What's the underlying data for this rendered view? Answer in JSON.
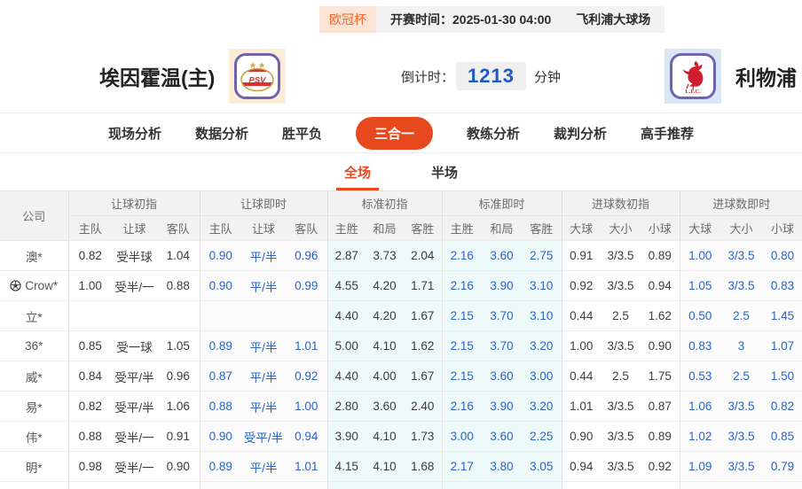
{
  "top_bar": {
    "league_badge": "欧冠杯",
    "kickoff_label": "开赛时间：2025-01-30 04:00",
    "venue": "飞利浦大球场"
  },
  "match": {
    "home_name": "埃因霍温(主)",
    "home_logo_text": "PSV",
    "away_name": "利物浦",
    "away_logo_text": "L.F.C.",
    "countdown_label": "倒计时：",
    "countdown_value": "1213",
    "countdown_unit": "分钟"
  },
  "nav": {
    "tabs": [
      {
        "key": "live-analysis",
        "label": "现场分析",
        "active": false
      },
      {
        "key": "data-analysis",
        "label": "数据分析",
        "active": false
      },
      {
        "key": "win-draw-lose",
        "label": "胜平负",
        "active": false
      },
      {
        "key": "three-in-one",
        "label": "三合一",
        "active": true
      },
      {
        "key": "coach-analysis",
        "label": "教练分析",
        "active": false
      },
      {
        "key": "referee-analysis",
        "label": "裁判分析",
        "active": false
      },
      {
        "key": "expert-picks",
        "label": "高手推荐",
        "active": false
      }
    ]
  },
  "sub_tabs": [
    {
      "key": "full-match",
      "label": "全场",
      "active": true
    },
    {
      "key": "half-match",
      "label": "半场",
      "active": false
    }
  ],
  "odds_table": {
    "company_header": "公司",
    "groups": [
      {
        "key": "handicap_initial",
        "label": "让球初指",
        "cols": [
          "主队",
          "让球",
          "客队"
        ]
      },
      {
        "key": "handicap_live",
        "label": "让球即时",
        "cols": [
          "主队",
          "让球",
          "客队"
        ]
      },
      {
        "key": "euro_initial",
        "label": "标准初指",
        "cols": [
          "主胜",
          "和局",
          "客胜"
        ]
      },
      {
        "key": "euro_live",
        "label": "标准即时",
        "cols": [
          "主胜",
          "和局",
          "客胜"
        ]
      },
      {
        "key": "goals_initial",
        "label": "进球数初指",
        "cols": [
          "大球",
          "大小",
          "小球"
        ]
      },
      {
        "key": "goals_live",
        "label": "进球数即时",
        "cols": [
          "大球",
          "大小",
          "小球"
        ]
      }
    ],
    "rows": [
      {
        "company": "澳*",
        "has_ball_icon": false,
        "handicap_initial": [
          "0.82",
          "受半球",
          "1.04"
        ],
        "handicap_live": [
          "0.90",
          "平/半",
          "0.96"
        ],
        "euro_initial": [
          "2.87",
          "3.73",
          "2.04"
        ],
        "euro_live": [
          "2.16",
          "3.60",
          "2.75"
        ],
        "goals_initial": [
          "0.91",
          "3/3.5",
          "0.89"
        ],
        "goals_live": [
          "1.00",
          "3/3.5",
          "0.80"
        ]
      },
      {
        "company": "Crow*",
        "has_ball_icon": true,
        "handicap_initial": [
          "1.00",
          "受半/一",
          "0.88"
        ],
        "handicap_live": [
          "0.90",
          "平/半",
          "0.99"
        ],
        "euro_initial": [
          "4.55",
          "4.20",
          "1.71"
        ],
        "euro_live": [
          "2.16",
          "3.90",
          "3.10"
        ],
        "goals_initial": [
          "0.92",
          "3/3.5",
          "0.94"
        ],
        "goals_live": [
          "1.05",
          "3/3.5",
          "0.83"
        ]
      },
      {
        "company": "立*",
        "has_ball_icon": false,
        "handicap_initial": [
          "",
          "",
          ""
        ],
        "handicap_live": [
          "",
          "",
          ""
        ],
        "euro_initial": [
          "4.40",
          "4.20",
          "1.67"
        ],
        "euro_live": [
          "2.15",
          "3.70",
          "3.10"
        ],
        "goals_initial": [
          "0.44",
          "2.5",
          "1.62"
        ],
        "goals_live": [
          "0.50",
          "2.5",
          "1.45"
        ]
      },
      {
        "company": "36*",
        "has_ball_icon": false,
        "handicap_initial": [
          "0.85",
          "受一球",
          "1.05"
        ],
        "handicap_live": [
          "0.89",
          "平/半",
          "1.01"
        ],
        "euro_initial": [
          "5.00",
          "4.10",
          "1.62"
        ],
        "euro_live": [
          "2.15",
          "3.70",
          "3.20"
        ],
        "goals_initial": [
          "1.00",
          "3/3.5",
          "0.90"
        ],
        "goals_live": [
          "0.83",
          "3",
          "1.07"
        ]
      },
      {
        "company": "威*",
        "has_ball_icon": false,
        "handicap_initial": [
          "0.84",
          "受平/半",
          "0.96"
        ],
        "handicap_live": [
          "0.87",
          "平/半",
          "0.92"
        ],
        "euro_initial": [
          "4.40",
          "4.00",
          "1.67"
        ],
        "euro_live": [
          "2.15",
          "3.60",
          "3.00"
        ],
        "goals_initial": [
          "0.44",
          "2.5",
          "1.75"
        ],
        "goals_live": [
          "0.53",
          "2.5",
          "1.50"
        ]
      },
      {
        "company": "易*",
        "has_ball_icon": false,
        "handicap_initial": [
          "0.82",
          "受平/半",
          "1.06"
        ],
        "handicap_live": [
          "0.88",
          "平/半",
          "1.00"
        ],
        "euro_initial": [
          "2.80",
          "3.60",
          "2.40"
        ],
        "euro_live": [
          "2.16",
          "3.90",
          "3.20"
        ],
        "goals_initial": [
          "1.01",
          "3/3.5",
          "0.87"
        ],
        "goals_live": [
          "1.06",
          "3/3.5",
          "0.82"
        ]
      },
      {
        "company": "伟*",
        "has_ball_icon": false,
        "handicap_initial": [
          "0.88",
          "受半/一",
          "0.91"
        ],
        "handicap_live": [
          "0.90",
          "受平/半",
          "0.94"
        ],
        "euro_initial": [
          "3.90",
          "4.10",
          "1.73"
        ],
        "euro_live": [
          "3.00",
          "3.60",
          "2.25"
        ],
        "goals_initial": [
          "0.90",
          "3/3.5",
          "0.89"
        ],
        "goals_live": [
          "1.02",
          "3/3.5",
          "0.85"
        ]
      },
      {
        "company": "明*",
        "has_ball_icon": false,
        "handicap_initial": [
          "0.98",
          "受半/一",
          "0.90"
        ],
        "handicap_live": [
          "0.89",
          "平/半",
          "1.01"
        ],
        "euro_initial": [
          "4.15",
          "4.10",
          "1.68"
        ],
        "euro_live": [
          "2.17",
          "3.80",
          "3.05"
        ],
        "goals_initial": [
          "0.94",
          "3/3.5",
          "0.92"
        ],
        "goals_live": [
          "1.09",
          "3/3.5",
          "0.79"
        ]
      }
    ]
  },
  "colors": {
    "accent_orange": "#e8481e",
    "badge_orange": "#f2652f",
    "live_odds_blue": "#2a64c6",
    "countdown_blue": "#1c5bc4",
    "euro_column_bg": "#eef9f9",
    "header_bg": "#f2f2f2"
  }
}
